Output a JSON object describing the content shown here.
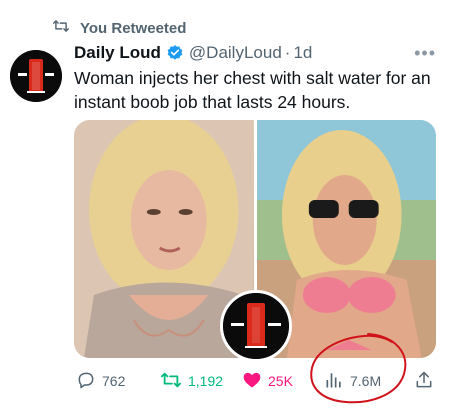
{
  "retweet": {
    "label": "You Retweeted"
  },
  "author": {
    "name": "Daily Loud",
    "handle": "@DailyLoud",
    "separator": "·",
    "time": "1d",
    "verified": true
  },
  "tweet": {
    "text": "Woman injects her chest with salt water for an instant boob job that lasts 24 hours."
  },
  "media": {
    "count": 2
  },
  "actions": {
    "replies": "762",
    "retweets": "1,192",
    "likes": "25K",
    "views": "7.6M"
  },
  "colors": {
    "retweet_active": "#00ba7c",
    "like_active": "#f91880",
    "verified_blue": "#1d9bf0",
    "annotation_red": "#d0131b",
    "brand_red": "#d92a1c"
  },
  "icons": {
    "retweet": "retweet-icon",
    "verified": "verified-badge-icon",
    "more": "more-icon",
    "reply": "reply-icon",
    "like": "heart-icon",
    "views": "views-icon",
    "share": "share-icon"
  }
}
